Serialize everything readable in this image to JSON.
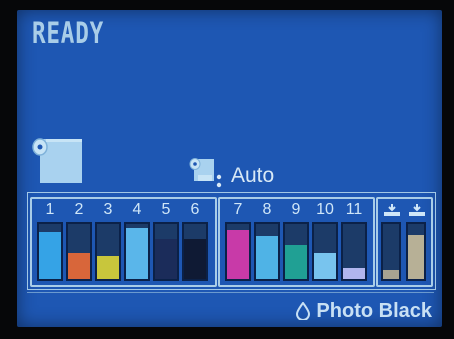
{
  "status": {
    "text": "READY"
  },
  "paper": {
    "roll_icon": "paper-roll-icon"
  },
  "cutter": {
    "icon": "roll-cut-icon",
    "label": "Auto"
  },
  "ink_groups": [
    {
      "name": "group-1",
      "slots": [
        {
          "label": "1",
          "level": 0.85,
          "color": "#35a3e6"
        },
        {
          "label": "2",
          "level": 0.48,
          "color": "#d8663a"
        },
        {
          "label": "3",
          "level": 0.42,
          "color": "#c8c63c"
        },
        {
          "label": "4",
          "level": 0.92,
          "color": "#5ab6ea"
        },
        {
          "label": "5",
          "level": 0.72,
          "color": "#1b2c5a"
        },
        {
          "label": "6",
          "level": 0.72,
          "color": "#0f1a34"
        }
      ]
    },
    {
      "name": "group-2",
      "slots": [
        {
          "label": "7",
          "level": 0.9,
          "color": "#c83aa8"
        },
        {
          "label": "8",
          "level": 0.78,
          "color": "#4fb3e6"
        },
        {
          "label": "9",
          "level": 0.62,
          "color": "#20a094"
        },
        {
          "label": "10",
          "level": 0.48,
          "color": "#78c4ee"
        },
        {
          "label": "11",
          "level": 0.2,
          "color": "#b1b6ee"
        }
      ]
    },
    {
      "name": "maintenance",
      "slots": [
        {
          "icon": "maintenance-box-icon",
          "level": 0.16,
          "color": "#a7a291"
        },
        {
          "icon": "maintenance-box-icon",
          "level": 0.8,
          "color": "#b7b096"
        }
      ]
    }
  ],
  "black_ink": {
    "icon": "ink-drop-icon",
    "label": "Photo Black"
  },
  "colors": {
    "screen": "#1e57b3",
    "text": "#a9cde8",
    "tank_empty": "#1c3b68"
  }
}
